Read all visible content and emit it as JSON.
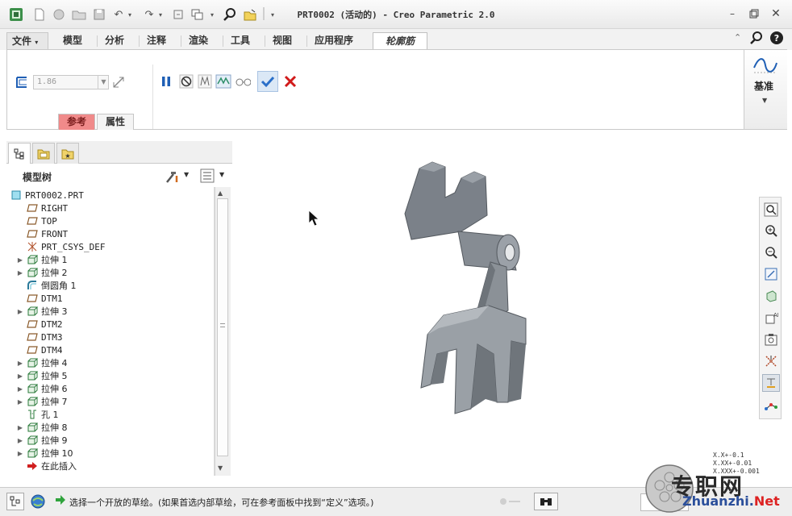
{
  "window": {
    "title": "PRT0002 (活动的) - Creo Parametric 2.0"
  },
  "ribbon_tabs": [
    {
      "label": "文件"
    },
    {
      "label": "模型"
    },
    {
      "label": "分析"
    },
    {
      "label": "注释"
    },
    {
      "label": "渲染"
    },
    {
      "label": "工具"
    },
    {
      "label": "视图"
    },
    {
      "label": "应用程序"
    },
    {
      "label": "轮廓筋"
    }
  ],
  "ribbon": {
    "thickness_value": "1.86",
    "sub_tabs": [
      "参考",
      "属性"
    ],
    "datum_label": "基准"
  },
  "model_tree": {
    "title": "模型树",
    "items": [
      {
        "label": "PRT0002.PRT",
        "icon": "part",
        "expand": ""
      },
      {
        "label": "RIGHT",
        "icon": "plane",
        "expand": ""
      },
      {
        "label": "TOP",
        "icon": "plane",
        "expand": ""
      },
      {
        "label": "FRONT",
        "icon": "plane",
        "expand": ""
      },
      {
        "label": "PRT_CSYS_DEF",
        "icon": "csys",
        "expand": ""
      },
      {
        "label": "拉伸 1",
        "icon": "extrude",
        "expand": "▶"
      },
      {
        "label": "拉伸 2",
        "icon": "extrude",
        "expand": "▶"
      },
      {
        "label": "倒圆角 1",
        "icon": "round",
        "expand": ""
      },
      {
        "label": "DTM1",
        "icon": "plane",
        "expand": ""
      },
      {
        "label": "拉伸 3",
        "icon": "extrude",
        "expand": "▶"
      },
      {
        "label": "DTM2",
        "icon": "plane",
        "expand": ""
      },
      {
        "label": "DTM3",
        "icon": "plane",
        "expand": ""
      },
      {
        "label": "DTM4",
        "icon": "plane",
        "expand": ""
      },
      {
        "label": "拉伸 4",
        "icon": "extrude",
        "expand": "▶"
      },
      {
        "label": "拉伸 5",
        "icon": "extrude",
        "expand": "▶"
      },
      {
        "label": "拉伸 6",
        "icon": "extrude",
        "expand": "▶"
      },
      {
        "label": "拉伸 7",
        "icon": "extrude",
        "expand": "▶"
      },
      {
        "label": "孔 1",
        "icon": "hole",
        "expand": ""
      },
      {
        "label": "拉伸 8",
        "icon": "extrude",
        "expand": "▶"
      },
      {
        "label": "拉伸 9",
        "icon": "extrude",
        "expand": "▶"
      },
      {
        "label": "拉伸 10",
        "icon": "extrude",
        "expand": "▶"
      },
      {
        "label": "在此插入",
        "icon": "insert",
        "expand": ""
      }
    ]
  },
  "status": {
    "message": "选择一个开放的草绘。(如果首选内部草绘，可在参考面板中找到“定义”选项。)"
  },
  "tolerances": [
    "X.X+-0.1",
    "X.XX+-0.01",
    "X.XXX+-0.001"
  ],
  "watermark": {
    "name": "专职网",
    "url_main": "Zhuanzhi.",
    "url_tld": "Net"
  },
  "colors": {
    "accent_blue": "#1f5fb5",
    "confirm_blue": "#2a6fc9",
    "cancel_red": "#d11a1a",
    "active_subtab": "#f08a8a",
    "model_gray": "#7d848c"
  }
}
